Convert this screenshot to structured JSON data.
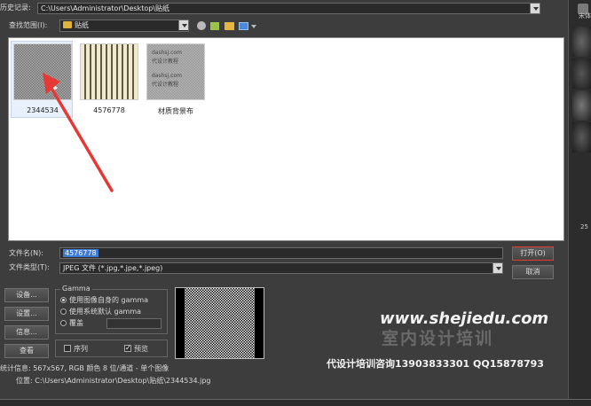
{
  "history": {
    "label": "历史记录:",
    "value": "C:\\Users\\Administrator\\Desktop\\贴纸"
  },
  "lookin": {
    "label": "查找范围(I):",
    "folder": "贴纸"
  },
  "toolbar_icons": [
    "back-icon",
    "up-folder-icon",
    "new-folder-icon",
    "view-menu-icon"
  ],
  "files": [
    {
      "name": "2344534",
      "texture": "noise-gray",
      "selected": true
    },
    {
      "name": "4576778",
      "texture": "vertical-stripes",
      "selected": false
    },
    {
      "name": "材质背景布",
      "texture": "watermark-gray",
      "selected": false,
      "watermark_lines": [
        "dashsj.com",
        "代设计教程",
        "dashsj.com",
        "代设计教程"
      ]
    }
  ],
  "filename": {
    "label": "文件名(N):",
    "value": "4576778"
  },
  "filetype": {
    "label": "文件类型(T):",
    "value": "JPEG 文件 (*.jpg,*.jpe,*.jpeg)"
  },
  "buttons": {
    "open": "打开(O)",
    "cancel": "取消",
    "setup": "设备...",
    "settings": "设置...",
    "info": "信息...",
    "view": "查看"
  },
  "gamma": {
    "title": "Gamma",
    "options": [
      "使用图像自身的 gamma",
      "使用系统默认 gamma",
      "覆盖"
    ],
    "selected": 0
  },
  "checks": {
    "sequence": "序列",
    "preview": "预览",
    "sequence_checked": false,
    "preview_checked": true
  },
  "stats": {
    "line1": "统计信息: 567x567, RGB 颜色 8 位/通道 - 单个图像",
    "line2": "位置: C:\\Users\\Administrator\\Desktop\\贴纸\\2344534.jpg"
  },
  "watermark": {
    "url": "www.shejiedu.com",
    "title": "室内设计培训",
    "contact": "代设计培训咨询13903833301  QQ15878793"
  },
  "side_labels": {
    "top": "宋体",
    "mid": "25"
  },
  "colors": {
    "accent_red": "#e53935",
    "selection_blue": "#3e7bd6",
    "dialog_bg": "#3d3d3d",
    "list_bg": "#ffffff"
  }
}
